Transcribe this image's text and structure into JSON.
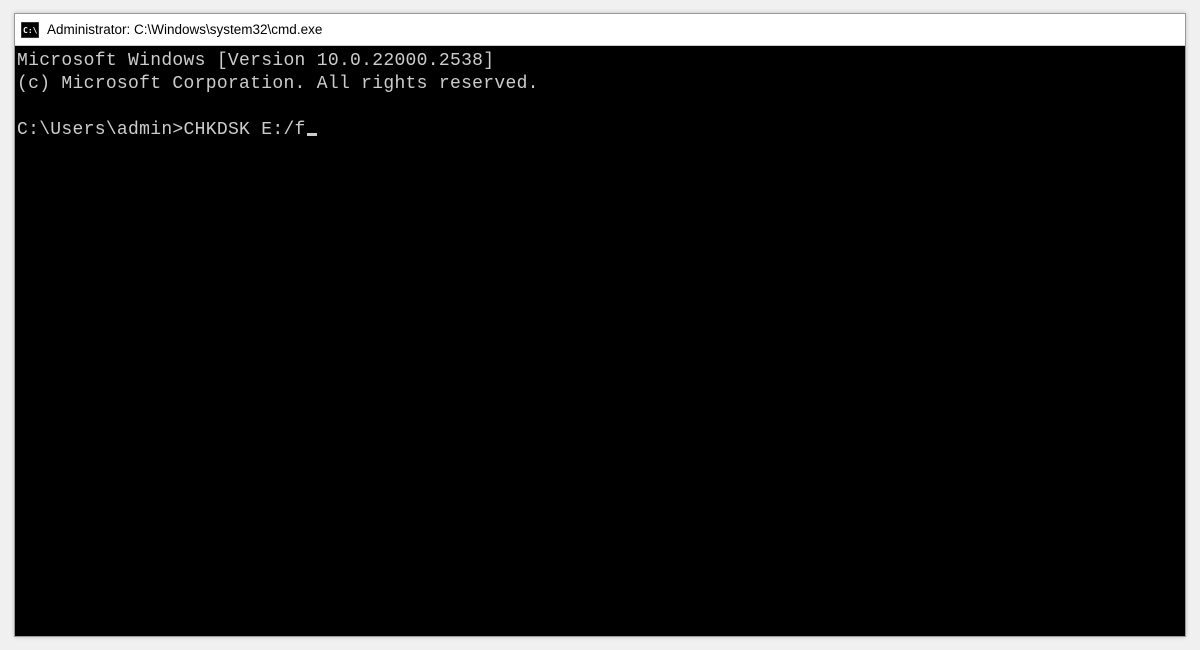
{
  "window": {
    "title": "Administrator: C:\\Windows\\system32\\cmd.exe",
    "icon_label": "C:\\"
  },
  "terminal": {
    "line1": "Microsoft Windows [Version 10.0.22000.2538]",
    "line2": "(c) Microsoft Corporation. All rights reserved.",
    "blank": "",
    "prompt": "C:\\Users\\admin>",
    "command": "CHKDSK E:/f"
  }
}
